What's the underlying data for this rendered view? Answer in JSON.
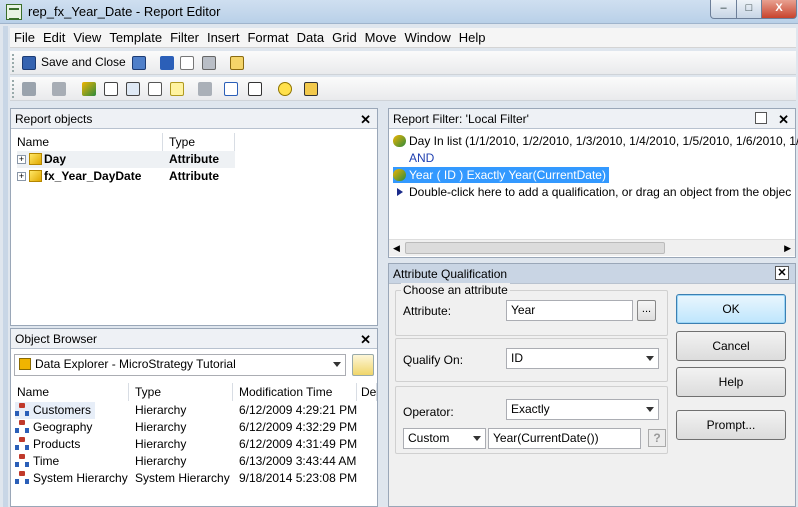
{
  "window": {
    "title": "rep_fx_Year_Date - Report Editor",
    "min_glyph": "–",
    "max_glyph": "□",
    "close_glyph": "X"
  },
  "menu": [
    "File",
    "Edit",
    "View",
    "Template",
    "Filter",
    "Insert",
    "Format",
    "Data",
    "Grid",
    "Move",
    "Window",
    "Help"
  ],
  "toolbar": {
    "save_close_label": "Save and Close"
  },
  "report_objects": {
    "title": "Report objects",
    "close_glyph": "✕",
    "columns": [
      "Name",
      "Type"
    ],
    "rows": [
      {
        "name": "Day",
        "type": "Attribute"
      },
      {
        "name": "fx_Year_DayDate",
        "type": "Attribute"
      }
    ]
  },
  "object_browser": {
    "title": "Object Browser",
    "close_glyph": "✕",
    "source": "Data Explorer - MicroStrategy Tutorial",
    "columns": [
      "Name",
      "Type",
      "Modification Time",
      "De"
    ],
    "rows": [
      {
        "name": "Customers",
        "type": "Hierarchy",
        "modified": "6/12/2009 4:29:21 PM"
      },
      {
        "name": "Geography",
        "type": "Hierarchy",
        "modified": "6/12/2009 4:32:29 PM"
      },
      {
        "name": "Products",
        "type": "Hierarchy",
        "modified": "6/12/2009 4:31:49 PM"
      },
      {
        "name": "Time",
        "type": "Hierarchy",
        "modified": "6/13/2009 3:43:44 AM"
      },
      {
        "name": "System Hierarchy",
        "type": "System Hierarchy",
        "modified": "9/18/2014 5:23:08 PM"
      }
    ]
  },
  "report_filter": {
    "title": "Report Filter: 'Local Filter'",
    "lines": [
      "Day In list (1/1/2010, 1/2/2010, 1/3/2010, 1/4/2010, 1/5/2010, 1/6/2010, 1/",
      "AND",
      "Year ( ID )  Exactly Year(CurrentDate)",
      "Double-click here to add a qualification, or drag an object from the objec"
    ]
  },
  "attribute_qualification": {
    "title": "Attribute Qualification",
    "close_glyph": "✕",
    "group_label": "Choose an attribute",
    "attribute_label": "Attribute:",
    "attribute_value": "Year",
    "browse_glyph": "...",
    "qualify_on_label": "Qualify On:",
    "qualify_on_value": "ID",
    "operator_label": "Operator:",
    "operator_value": "Exactly",
    "value_mode": "Custom",
    "value_expression": "Year(CurrentDate())",
    "buttons": {
      "ok": "OK",
      "cancel": "Cancel",
      "help": "Help",
      "prompt": "Prompt..."
    }
  }
}
